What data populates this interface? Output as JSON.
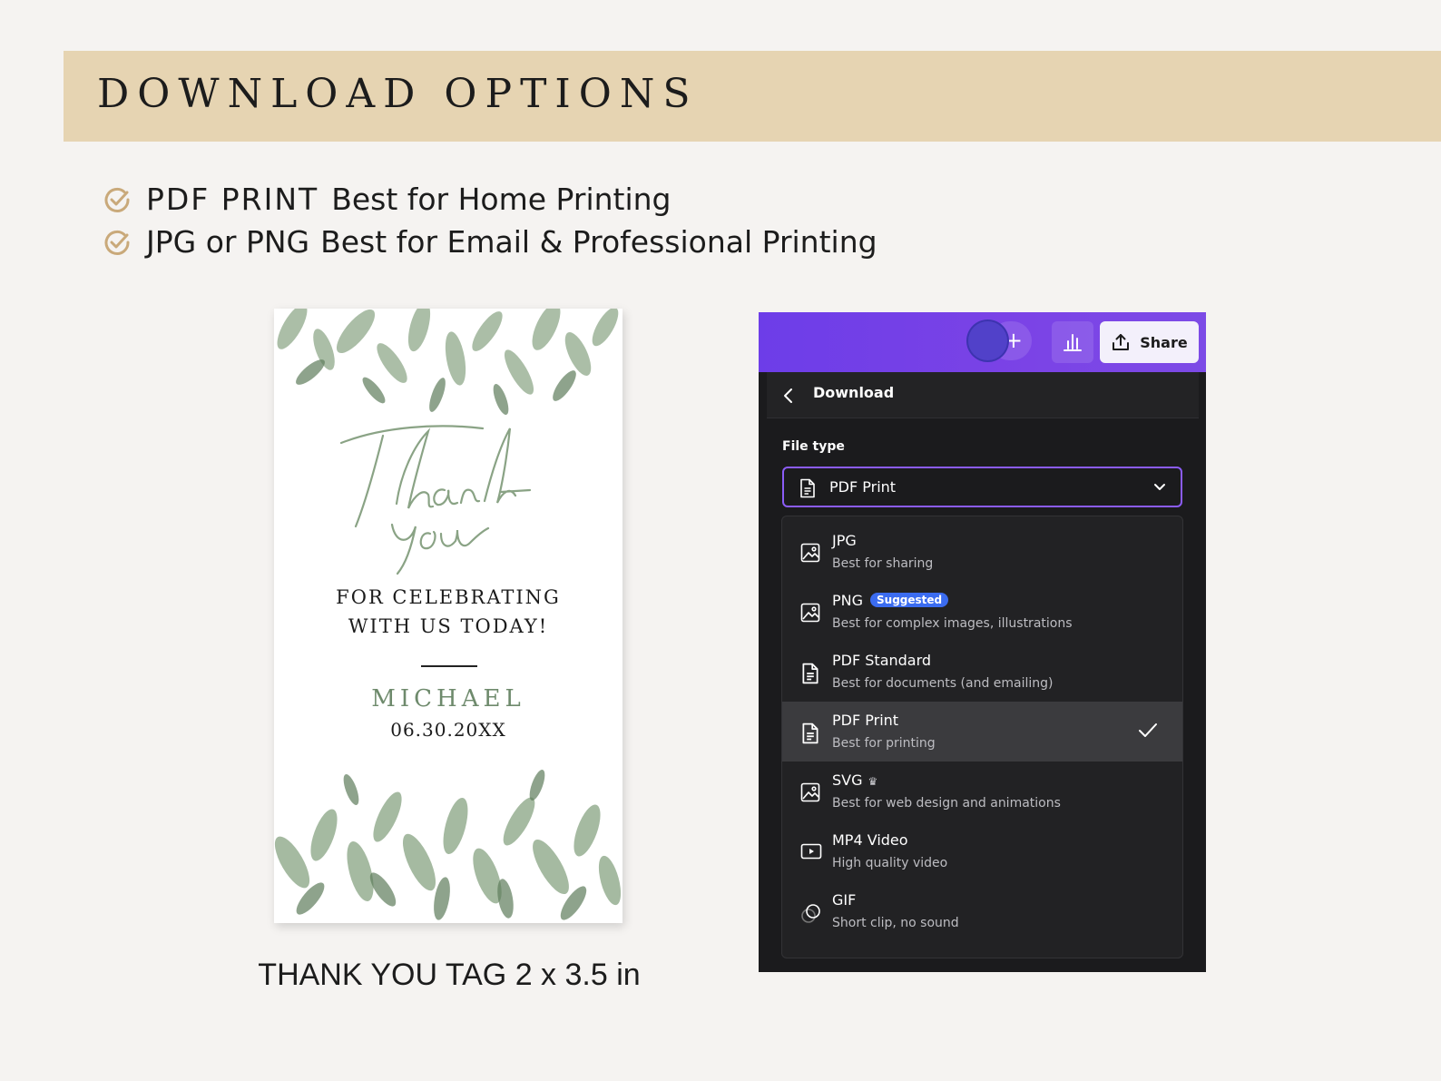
{
  "banner": {
    "title": "DOWNLOAD OPTIONS"
  },
  "bullets": [
    {
      "strong": "PDF PRINT",
      "text": "Best for Home Printing"
    },
    {
      "strong": "JPG or PNG",
      "text": "Best for Email & Professional Printing"
    }
  ],
  "colors": {
    "banner": "#e6d4b2",
    "check_icon": "#c9a97a",
    "accent_purple": "#7b43e6",
    "leaf_green": "#6e8a6c"
  },
  "tag": {
    "script_text": "Thank you",
    "line1": "FOR CELEBRATING",
    "line2": "WITH US TODAY!",
    "name": "MICHAEL",
    "date": "06.30.20XX",
    "caption_strong": "THANK YOU TAG",
    "caption_size": "2 x 3.5 in"
  },
  "panel": {
    "topbar": {
      "share_label": "Share",
      "plus_label": "+"
    },
    "header": {
      "title": "Download"
    },
    "file_type_label": "File type",
    "selected_value": "PDF Print",
    "options": [
      {
        "name": "JPG",
        "desc": "Best for sharing",
        "icon": "image-icon"
      },
      {
        "name": "PNG",
        "desc": "Best for complex images, illustrations",
        "badge": "Suggested",
        "icon": "image-icon"
      },
      {
        "name": "PDF Standard",
        "desc": "Best for documents (and emailing)",
        "icon": "document-icon"
      },
      {
        "name": "PDF Print",
        "desc": "Best for printing",
        "icon": "document-icon",
        "selected": true
      },
      {
        "name": "SVG",
        "desc": "Best for web design and animations",
        "icon": "image-icon",
        "premium": "crown-icon"
      },
      {
        "name": "MP4 Video",
        "desc": "High quality video",
        "icon": "video-icon"
      },
      {
        "name": "GIF",
        "desc": "Short clip, no sound",
        "icon": "gif-icon"
      }
    ]
  }
}
